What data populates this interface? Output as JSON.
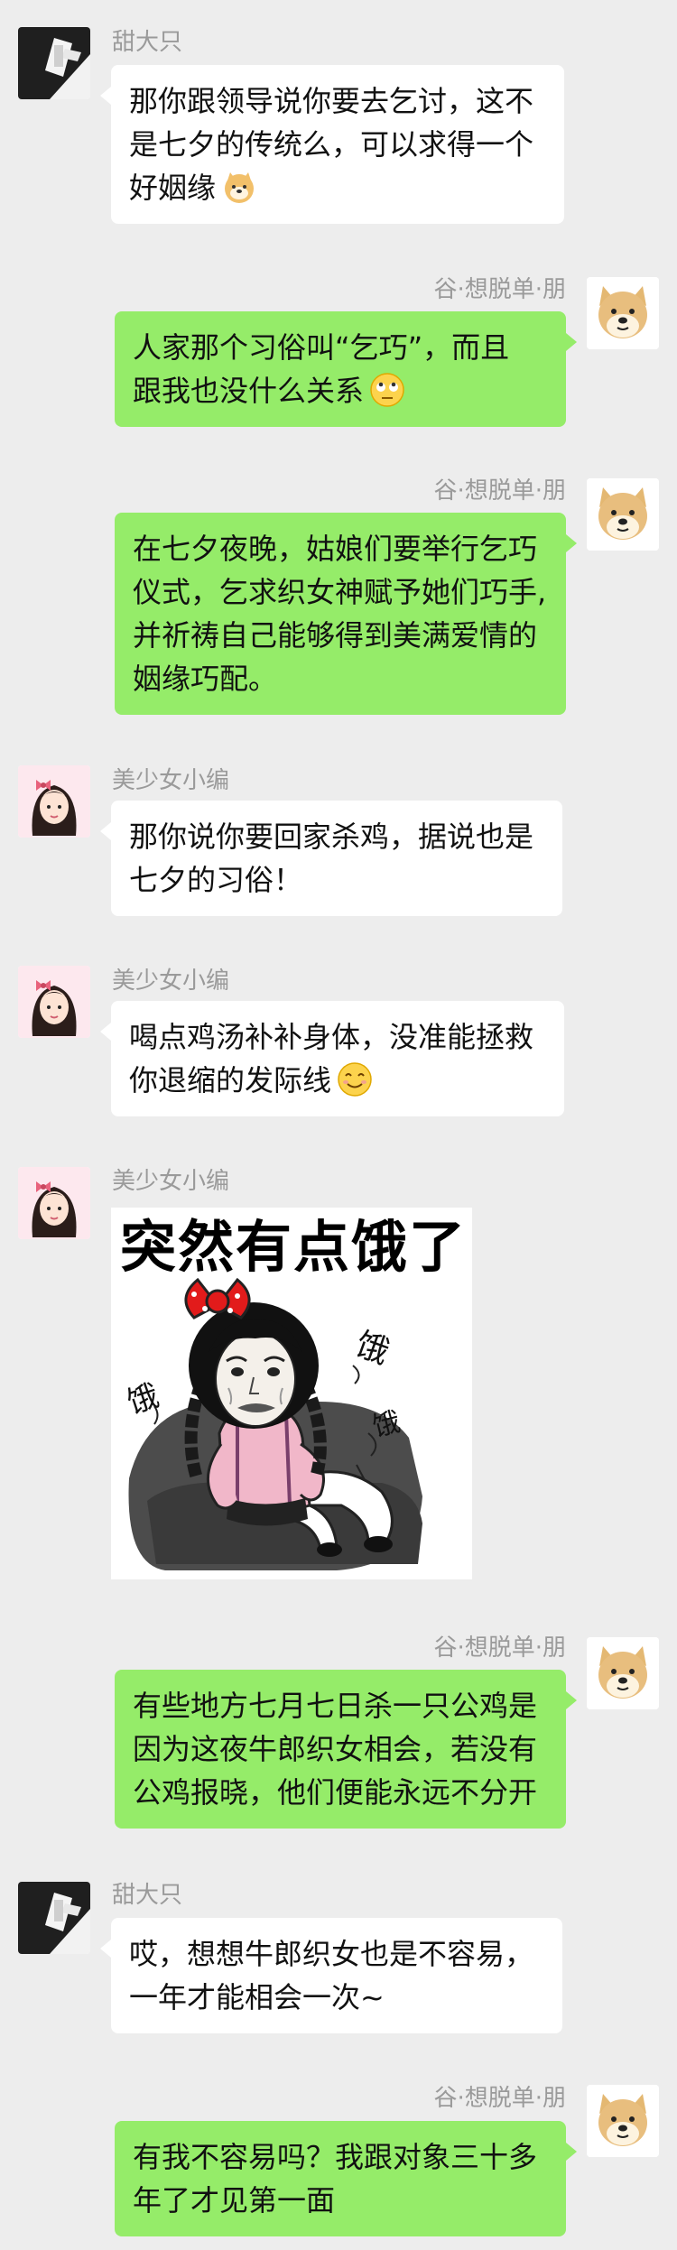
{
  "users": {
    "tian_da_zhi": "甜大只",
    "gu": "谷·想脱单·朋",
    "editor": "美少女小编"
  },
  "messages": [
    {
      "id": "m1",
      "line1": "那你跟领导说你要去乞讨，这不",
      "line2": "是七夕的传统么，可以求得一个",
      "line3": "好姻缘"
    },
    {
      "id": "m2",
      "line1": "人家那个习俗叫“乞巧”，而且",
      "line2": "跟我也没什么关系"
    },
    {
      "id": "m3",
      "line1": "在七夕夜晚，姑娘们要举行乞巧",
      "line2": "仪式，乞求织女神赋予她们巧手,",
      "line3": "并祈祷自己能够得到美满爱情的",
      "line4": "姻缘巧配。"
    },
    {
      "id": "m4",
      "line1": "那你说你要回家杀鸡，据说也是",
      "line2": "七夕的习俗！"
    },
    {
      "id": "m5",
      "line1": "喝点鸡汤补补身体，没准能拯救",
      "line2": "你退缩的发际线"
    },
    {
      "id": "m6",
      "sticker_text": "突然有点饿了",
      "hunger_word": "饿"
    },
    {
      "id": "m7",
      "line1": "有些地方七月七日杀一只公鸡是",
      "line2": "因为这夜牛郎织女相会，若没有",
      "line3": "公鸡报晓，他们便能永远不分开"
    },
    {
      "id": "m8",
      "line1": "哎，想想牛郎织女也是不容易，",
      "line2": "一年才能相会一次~"
    },
    {
      "id": "m9",
      "line1": "有我不容易吗？我跟对象三十多",
      "line2": "年了才见第一面"
    }
  ],
  "colors": {
    "background": "#ededed",
    "bubble_self": "#95ec69",
    "bubble_other": "#ffffff",
    "name_text": "#9a9a9a"
  },
  "icons": {
    "doge": "doge-emoji",
    "eye_roll": "eye-roll-emoji",
    "smile": "smile-emoji"
  }
}
